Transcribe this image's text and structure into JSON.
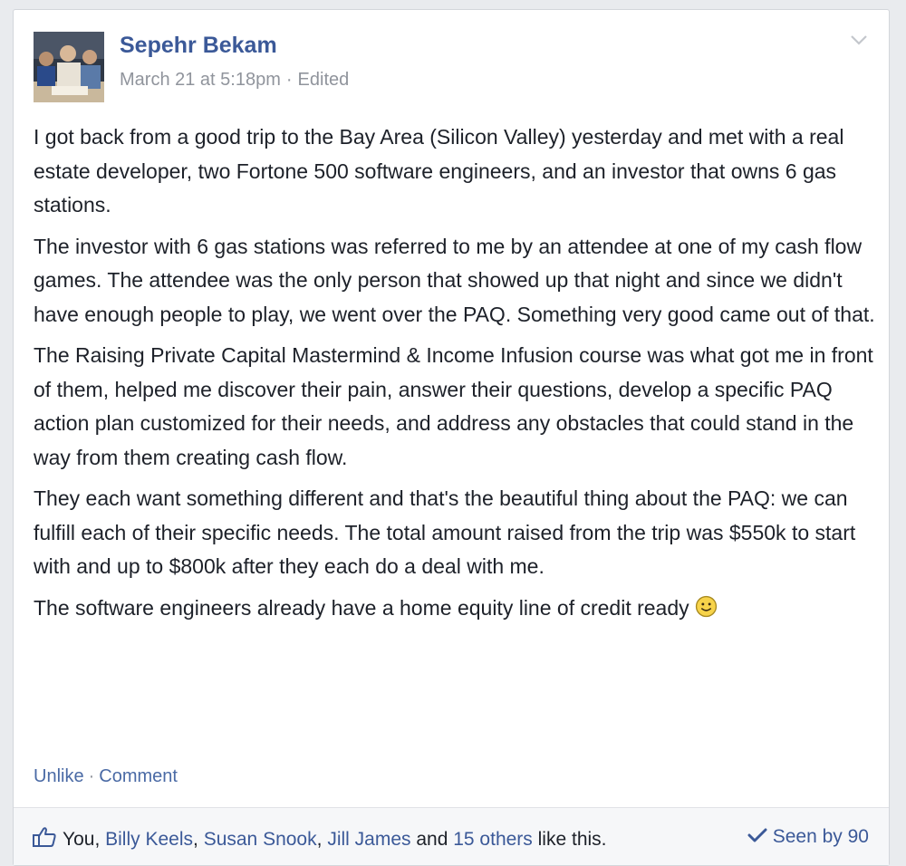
{
  "post": {
    "author": "Sepehr Bekam",
    "timestamp": "March 21 at 5:18pm",
    "edited_label": "Edited",
    "meta_separator": "·",
    "paragraphs": [
      "I got back from a good trip to the Bay Area (Silicon Valley) yesterday and met with a real estate developer, two Fortone 500 software engineers, and an investor that owns 6 gas stations.",
      "The investor with 6 gas stations was referred to me by an attendee at one of my cash flow games. The attendee was the only person that showed up that night and since we didn't have enough people to play, we went over the PAQ. Something very good came out of that.",
      "The Raising Private Capital Mastermind & Income Infusion course was what got me in front of them, helped me discover their pain, answer their questions, develop a specific PAQ action plan customized for their needs, and address any obstacles that could stand in the way from them creating cash flow.",
      "They each want something different and that's the beautiful thing about the PAQ: we can fulfill each of their specific needs. The total amount raised from the trip was $550k to start with and up to $800k after they each do a deal with me.",
      "The software engineers already have a home equity line of credit ready"
    ],
    "emoticon_icon": "smiley-icon",
    "avatar_icon": "profile-photo"
  },
  "actions": {
    "unlike_label": "Unlike",
    "separator": "·",
    "comment_label": "Comment"
  },
  "likes": {
    "icon": "thumbs-up-icon",
    "you": "You",
    "comma1": ",",
    "person1": "Billy Keels",
    "comma2": ",",
    "person2": "Susan Snook",
    "comma3": ",",
    "person3": "Jill James",
    "and_text": "and",
    "others": "15 others",
    "suffix": "like this."
  },
  "seen": {
    "icon": "checkmark-icon",
    "label": "Seen by 90"
  },
  "colors": {
    "link": "#3b5998",
    "text": "#1d2129",
    "muted": "#90949c",
    "background": "#e9ebee"
  }
}
